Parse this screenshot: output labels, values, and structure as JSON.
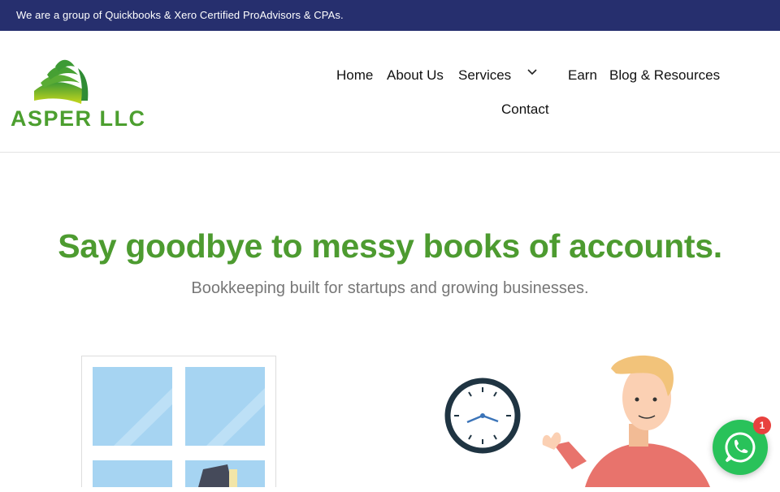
{
  "topbar": {
    "text": "We are a group of Quickbooks & Xero Certified ProAdvisors & CPAs."
  },
  "logo": {
    "text": "ASPER LLC",
    "icon": "leaf-fan-icon"
  },
  "nav": {
    "home": "Home",
    "about": "About Us",
    "services": "Services",
    "earn": "Earn",
    "blog": "Blog & Resources",
    "contact": "Contact"
  },
  "hero": {
    "title": "Say goodbye to messy books of accounts.",
    "subtitle": "Bookkeeping built for startups and growing businesses."
  },
  "whatsapp": {
    "icon": "whatsapp-icon",
    "badge": "1"
  },
  "colors": {
    "topbar": "#262f6e",
    "brand_green": "#4d9b30",
    "whatsapp_green": "#29c25a",
    "badge_red": "#e8413e"
  }
}
